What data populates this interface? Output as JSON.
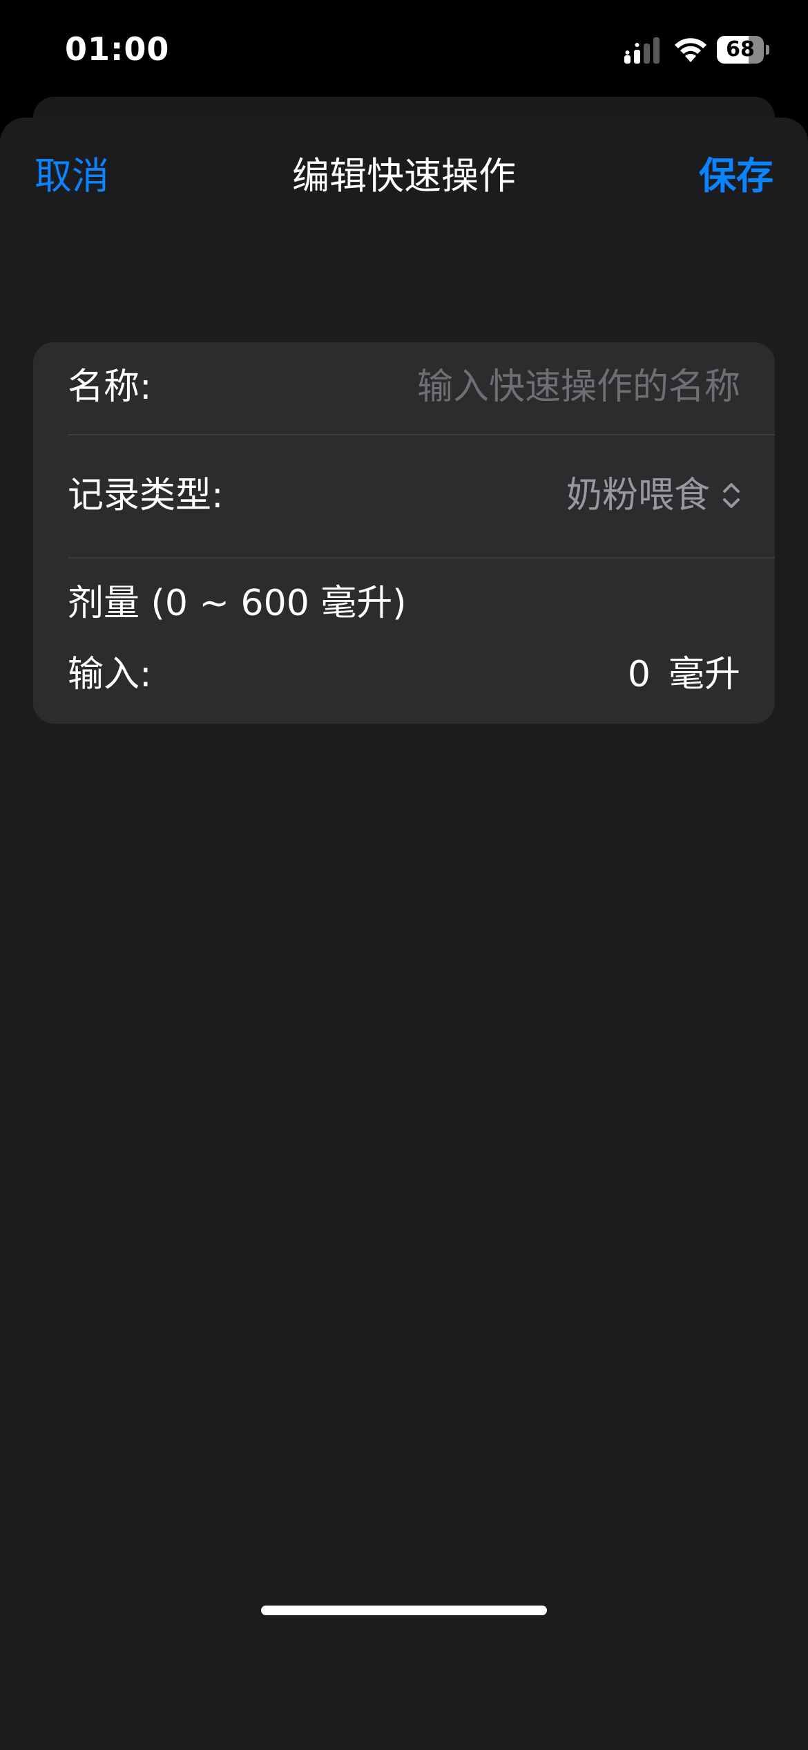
{
  "status_bar": {
    "time": "01:00",
    "battery_level": 68,
    "battery_text": "68",
    "icons": [
      "signal-icon",
      "wifi-icon",
      "battery-icon"
    ]
  },
  "nav": {
    "cancel_label": "取消",
    "title": "编辑快速操作",
    "save_label": "保存"
  },
  "form": {
    "name": {
      "label": "名称:",
      "value": "",
      "placeholder": "输入快速操作的名称"
    },
    "record_type": {
      "label": "记录类型:",
      "value": "奶粉喂食",
      "icon": "chevron-up-down-icon"
    },
    "dose": {
      "title": "剂量 (0 ~ 600 毫升)",
      "input_label": "输入:",
      "value": "0",
      "unit": "毫升"
    }
  },
  "colors": {
    "accent": "#0a84ff",
    "background": "#1c1c1e",
    "card": "#2c2c2e",
    "placeholder": "#6e6e73",
    "secondary_text": "#98989f"
  }
}
